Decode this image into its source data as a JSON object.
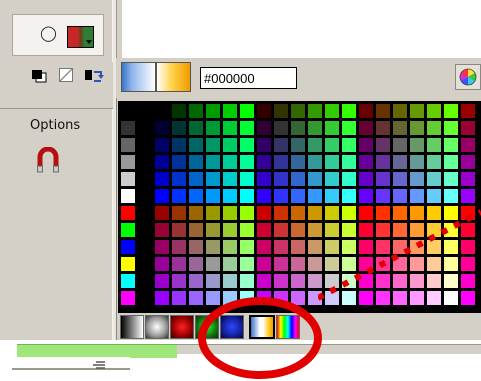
{
  "color_mixer": {
    "hex_value": "#000000"
  },
  "options_panel": {
    "title": "Options"
  },
  "colors": {
    "selection": "#ff0000",
    "annotation": "#e00000",
    "panel": "#d4d0c8",
    "green_strip": "#9fe77a"
  },
  "icons": [
    "paint-bucket-icon",
    "black-white-icon",
    "no-color-icon",
    "swap-colors-icon",
    "snap-magnet-icon",
    "color-picker-icon"
  ]
}
